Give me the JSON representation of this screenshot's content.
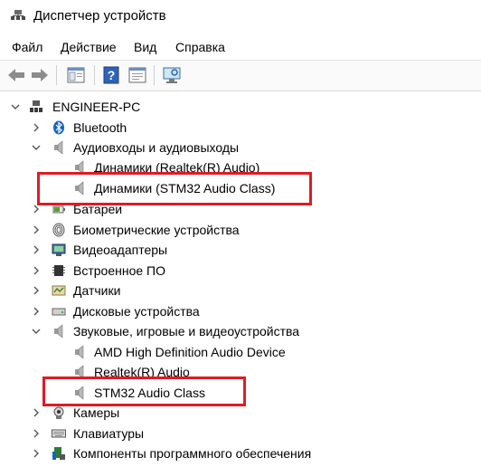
{
  "window": {
    "title": "Диспетчер устройств"
  },
  "menu": [
    "Файл",
    "Действие",
    "Вид",
    "Справка"
  ],
  "toolbar": {
    "buttons": [
      "back-arrow-icon",
      "forward-arrow-icon",
      "properties-icon",
      "help-icon",
      "update-driver-icon",
      "monitor-scan-icon"
    ]
  },
  "tree": {
    "root": "ENGINEER-PC",
    "items": [
      {
        "label": "Bluetooth",
        "icon": "bluetooth-icon",
        "expanded": false
      },
      {
        "label": "Аудиовходы и аудиовыходы",
        "icon": "speaker-icon",
        "expanded": true,
        "children": [
          "Динамики (Realtek(R) Audio)",
          "Динамики (STM32 Audio Class)"
        ]
      },
      {
        "label": "Батареи",
        "icon": "battery-icon",
        "expanded": false
      },
      {
        "label": "Биометрические устройства",
        "icon": "fingerprint-icon",
        "expanded": false
      },
      {
        "label": "Видеоадаптеры",
        "icon": "display-adapter-icon",
        "expanded": false
      },
      {
        "label": "Встроенное ПО",
        "icon": "firmware-icon",
        "expanded": false
      },
      {
        "label": "Датчики",
        "icon": "sensor-icon",
        "expanded": false
      },
      {
        "label": "Дисковые устройства",
        "icon": "disk-drive-icon",
        "expanded": false
      },
      {
        "label": "Звуковые, игровые и видеоустройства",
        "icon": "speaker-icon",
        "expanded": true,
        "children": [
          "AMD High Definition Audio Device",
          "Realtek(R) Audio",
          "STM32 Audio Class"
        ]
      },
      {
        "label": "Камеры",
        "icon": "camera-icon",
        "expanded": false
      },
      {
        "label": "Клавиатуры",
        "icon": "keyboard-icon",
        "expanded": false
      },
      {
        "label": "Компоненты программного обеспечения",
        "icon": "software-component-icon",
        "expanded": false
      }
    ]
  },
  "colors": {
    "highlight": "#e01b24",
    "bluetooth": "#1565c0"
  }
}
